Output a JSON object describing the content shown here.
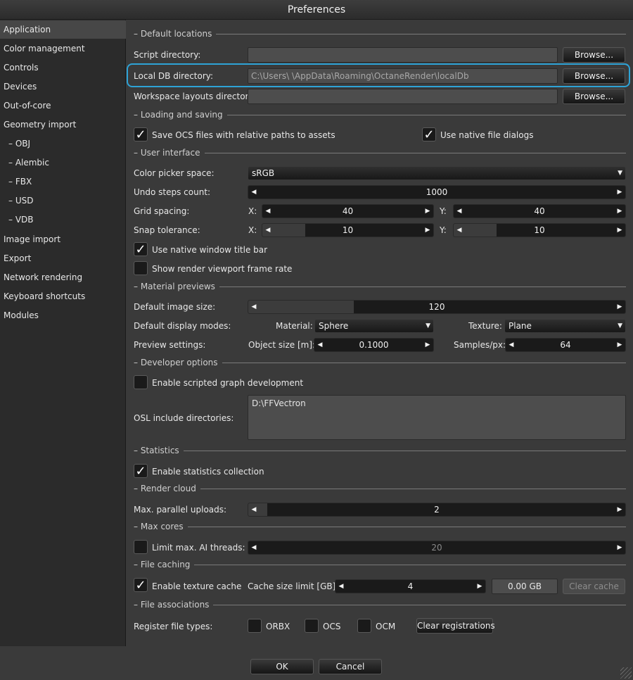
{
  "window": {
    "title": "Preferences"
  },
  "sidebar": {
    "items": [
      {
        "label": "Application",
        "active": true
      },
      {
        "label": "Color management"
      },
      {
        "label": "Controls"
      },
      {
        "label": "Devices"
      },
      {
        "label": "Out-of-core"
      },
      {
        "label": "Geometry import"
      },
      {
        "label": "–  OBJ"
      },
      {
        "label": "–  Alembic"
      },
      {
        "label": "–  FBX"
      },
      {
        "label": "–  USD"
      },
      {
        "label": "–  VDB"
      },
      {
        "label": "Image import"
      },
      {
        "label": "Export"
      },
      {
        "label": "Network rendering"
      },
      {
        "label": "Keyboard shortcuts"
      },
      {
        "label": "Modules"
      }
    ]
  },
  "sections": {
    "default_locations": "– Default locations",
    "loading_saving": "– Loading and saving",
    "user_interface": "– User interface",
    "material_previews": "– Material previews",
    "developer_options": "– Developer options",
    "statistics": "– Statistics",
    "render_cloud": "– Render cloud",
    "max_cores": "– Max cores",
    "file_caching": "– File caching",
    "file_associations": "– File associations"
  },
  "default_locations": {
    "script_dir_label": "Script directory:",
    "script_dir_value": "",
    "local_db_label": "Local DB directory:",
    "local_db_value": "C:\\Users\\          \\AppData\\Roaming\\OctaneRender\\localDb",
    "workspace_label": "Workspace layouts directory:",
    "workspace_value": "",
    "browse_label": "Browse..."
  },
  "loading_saving": {
    "save_relative_label": "Save OCS files with relative paths to assets",
    "save_relative_checked": true,
    "native_dialogs_label": "Use native file dialogs",
    "native_dialogs_checked": true
  },
  "user_interface": {
    "color_picker_label": "Color picker space:",
    "color_picker_value": "sRGB",
    "undo_label": "Undo steps count:",
    "undo_value": "1000",
    "grid_label": "Grid spacing:",
    "snap_label": "Snap tolerance:",
    "x_label": "X:",
    "y_label": "Y:",
    "grid_x": "40",
    "grid_y": "40",
    "snap_x": "10",
    "snap_y": "10",
    "native_title_label": "Use native window title bar",
    "native_title_checked": true,
    "frame_rate_label": "Show render viewport frame rate",
    "frame_rate_checked": false
  },
  "material_previews": {
    "image_size_label": "Default image size:",
    "image_size_value": "120",
    "display_modes_label": "Default display modes:",
    "material_label": "Material:",
    "material_value": "Sphere",
    "texture_label": "Texture:",
    "texture_value": "Plane",
    "preview_settings_label": "Preview settings:",
    "object_size_label": "Object size [m]:",
    "object_size_value": "0.1000",
    "samples_label": "Samples/px:",
    "samples_value": "64"
  },
  "developer_options": {
    "scripted_graph_label": "Enable scripted graph development",
    "scripted_graph_checked": false,
    "osl_label": "OSL include directories:",
    "osl_value": "D:\\FFVectron"
  },
  "statistics": {
    "collection_label": "Enable statistics collection",
    "collection_checked": true
  },
  "render_cloud": {
    "uploads_label": "Max. parallel uploads:",
    "uploads_value": "2"
  },
  "max_cores": {
    "limit_label": "Limit max. AI threads:",
    "limit_checked": false,
    "threads_value": "20"
  },
  "file_caching": {
    "texture_cache_label": "Enable texture cache",
    "texture_cache_checked": true,
    "cache_size_label": "Cache size limit [GB]:",
    "cache_size_value": "4",
    "cache_used_value": "0.00 GB",
    "clear_cache_label": "Clear cache"
  },
  "file_associations": {
    "register_label": "Register file types:",
    "orbx_label": "ORBX",
    "ocs_label": "OCS",
    "ocm_label": "OCM",
    "clear_registrations_label": "Clear registrations"
  },
  "footer": {
    "ok_label": "OK",
    "cancel_label": "Cancel"
  },
  "icons": {
    "left_arrow": "◀",
    "right_arrow": "▶",
    "dropdown": "▼",
    "check": "✓"
  },
  "colors": {
    "highlight": "#2ea3d6"
  }
}
